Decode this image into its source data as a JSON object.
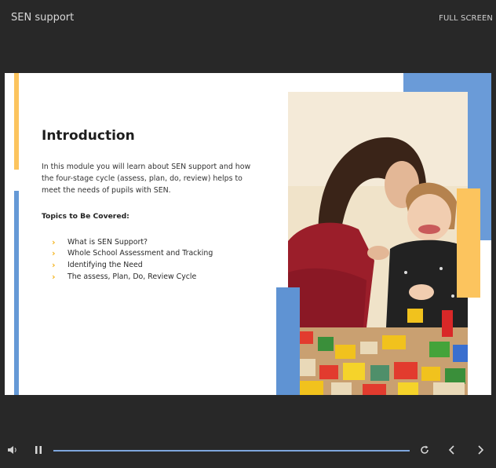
{
  "app": {
    "title": "SEN support",
    "fullscreen_label": "FULL SCREEN"
  },
  "slide": {
    "title": "Introduction",
    "description": "In this module you will learn about SEN support and how the four-stage cycle (assess, plan, do, review) helps to meet the needs of pupils with SEN.",
    "topics_heading": "Topics to Be Covered:",
    "topics": [
      "What is SEN Support?",
      "Whole School Assessment and Tracking",
      "Identifying the Need",
      "The assess, Plan, Do, Review Cycle"
    ],
    "bullet_icon": "chevron-right-icon",
    "colors": {
      "accent_yellow": "#fcc45e",
      "accent_blue": "#6a9bd8",
      "bullet": "#f4b31c"
    }
  },
  "player": {
    "progress": 1.0,
    "icons": [
      "volume-icon",
      "pause-icon",
      "replay-icon",
      "chevron-left-icon",
      "chevron-right-icon"
    ]
  }
}
